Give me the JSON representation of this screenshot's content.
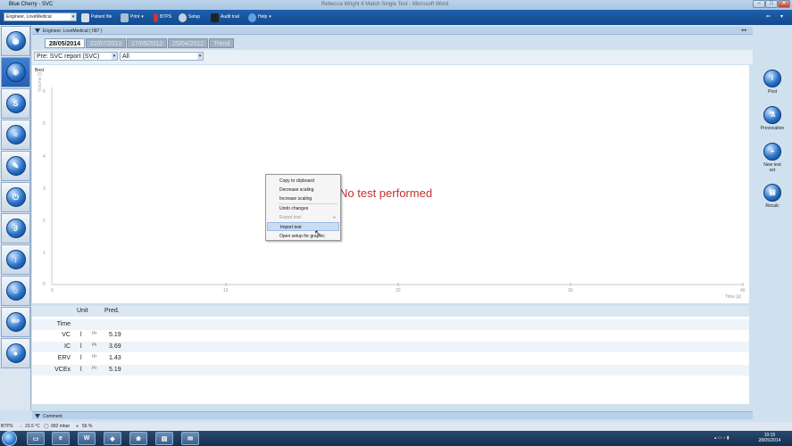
{
  "window": {
    "title": "Blue Cherry - SVC",
    "caption": "Rebecca Wright 8 Match Single Test - Microsoft Word"
  },
  "toolbar": {
    "engineer": "Engineer, LoveMedical",
    "patient_file": "Patient file",
    "print": "Print",
    "btps": "BTPS",
    "setup": "Setup",
    "audit_trail": "Audit trail",
    "help": "Help"
  },
  "header": {
    "title": "Engineer, LoveMedical ( 087 )"
  },
  "tabs": [
    "28/05/2014",
    "22/07/2013",
    "17/05/2012",
    "25/04/2012",
    "Trend"
  ],
  "selectors": {
    "report": "Pre: SVC report (SVC)",
    "filter": "All"
  },
  "plot": {
    "best_label": "Best",
    "no_test": "No test performed",
    "y_label": "Volume [l]",
    "x_label": "Time [s]",
    "y_ticks": [
      "6",
      "5",
      "4",
      "3",
      "2",
      "1",
      "0"
    ],
    "x_ticks": [
      "0",
      "10",
      "20",
      "30",
      "40"
    ]
  },
  "context_menu": {
    "items": [
      "Copy to clipboard",
      "Decrease scaling",
      "Increase scaling",
      "Undo changes",
      "Export test",
      "Import test",
      "Open setup for graphic"
    ]
  },
  "table": {
    "headers": {
      "unit": "Unit",
      "pred": "Pred."
    },
    "rows": [
      {
        "label": "Time",
        "unit": "",
        "sup": "",
        "pred": ""
      },
      {
        "label": "VC",
        "unit": "l",
        "sup": "(1)",
        "pred": "5.19"
      },
      {
        "label": "IC",
        "unit": "l",
        "sup": "(3)",
        "pred": "3.69"
      },
      {
        "label": "ERV",
        "unit": "l",
        "sup": "(1)",
        "pred": "1.43"
      },
      {
        "label": "VCEx",
        "unit": "l",
        "sup": "(1)",
        "pred": "5.19"
      }
    ]
  },
  "right_actions": [
    {
      "label": "Post",
      "icon": "post-icon"
    },
    {
      "label": "Provocation",
      "icon": "provocation-icon"
    },
    {
      "label": "New test set",
      "icon": "new-test-set-icon"
    },
    {
      "label": "Recalc",
      "icon": "recalc-icon"
    }
  ],
  "comment": {
    "label": "Comment"
  },
  "status": {
    "btps": "BTPS:",
    "temp": "23.5 °C",
    "pressure": "992 mbar",
    "humidity": "56 %"
  },
  "clock": {
    "time": "10:15",
    "date": "28/05/2014"
  }
}
